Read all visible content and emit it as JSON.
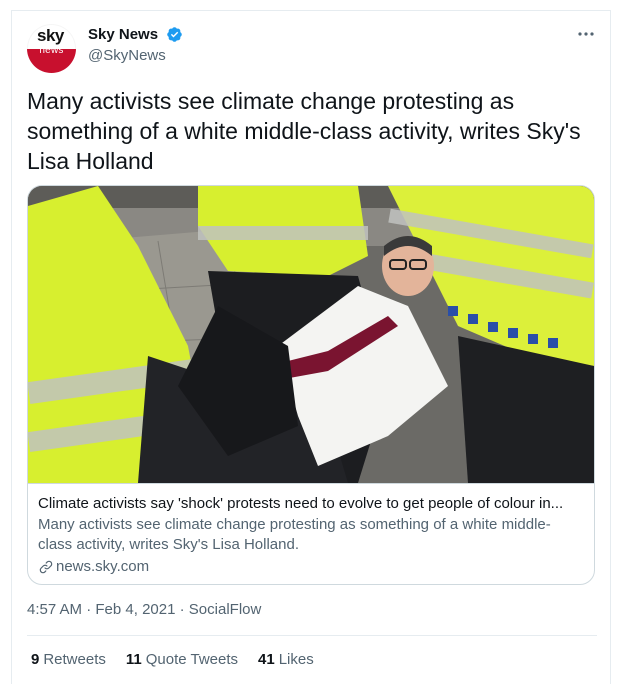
{
  "tweet": {
    "author": {
      "display_name": "Sky News",
      "handle": "@SkyNews",
      "verified": true,
      "avatar_logo_top": "sky",
      "avatar_logo_bottom": "news"
    },
    "more_icon": "more-horizontal-icon",
    "text": "Many activists see climate change protesting as something of a white middle-class activity, writes Sky's Lisa Holland",
    "card": {
      "title": "Climate activists say 'shock' protests need to evolve to get people of colour in...",
      "description": "Many activists see climate change protesting as something of a white middle-class activity, writes Sky's Lisa Holland.",
      "domain": "news.sky.com",
      "domain_icon": "link-icon"
    },
    "time": "4:57 AM",
    "date": "Feb 4, 2021",
    "source": "SocialFlow",
    "separator": "·",
    "stats": [
      {
        "count": "9",
        "label": "Retweets"
      },
      {
        "count": "11",
        "label": "Quote Tweets"
      },
      {
        "count": "41",
        "label": "Likes"
      }
    ]
  },
  "colors": {
    "text_primary": "#0f1419",
    "text_secondary": "#536471",
    "border": "#cfd9de",
    "verified_blue": "#1d9bf0",
    "sky_red": "#c8102e"
  }
}
